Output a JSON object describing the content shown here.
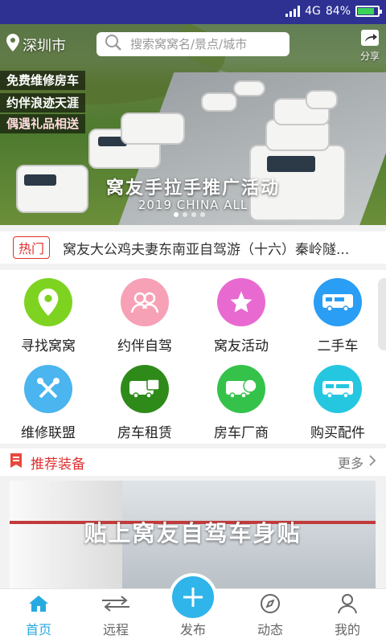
{
  "status_bar": {
    "network": "4G",
    "battery": "84%",
    "battery_level": 0.84
  },
  "header": {
    "location": "深圳市",
    "search_placeholder": "搜索窝窝名/景点/城市",
    "share_label": "分享"
  },
  "banner": {
    "promo_tags": [
      "免费维修房车",
      "约伴浪迹天涯",
      "偶遇礼品相送"
    ],
    "title": "窝友手拉手推广活动",
    "subtitle": "2019 CHINA ALL",
    "slide_count": 4,
    "active_slide": 0
  },
  "hot": {
    "label": "热门",
    "text": "窝友大公鸡夫妻东南亚自驾游（十六）秦岭隧..."
  },
  "grid": [
    {
      "label": "寻找窝窝",
      "icon": "location-pin-icon",
      "color": "#7ed321"
    },
    {
      "label": "约伴自驾",
      "icon": "companions-icon",
      "color": "#f7a1b6"
    },
    {
      "label": "窝友活动",
      "icon": "star-icon",
      "color": "#e86ad1"
    },
    {
      "label": "二手车",
      "icon": "rv-icon",
      "color": "#2a9df4"
    },
    {
      "label": "维修联盟",
      "icon": "tools-icon",
      "color": "#4ab5ee"
    },
    {
      "label": "房车租赁",
      "icon": "rv-rent-icon",
      "color": "#2e8b1a"
    },
    {
      "label": "房车厂商",
      "icon": "rv-view-icon",
      "color": "#35c24a"
    },
    {
      "label": "购买配件",
      "icon": "rv-parts-icon",
      "color": "#25c7e0"
    }
  ],
  "recommend": {
    "title": "推荐装备",
    "more": "更多",
    "card_caption": "贴上窝友自驾车身贴"
  },
  "tabs": [
    {
      "label": "首页",
      "icon": "home-icon",
      "active": true
    },
    {
      "label": "远程",
      "icon": "swap-arrows-icon",
      "active": false
    },
    {
      "label": "发布",
      "icon": "plus-icon",
      "active": false
    },
    {
      "label": "动态",
      "icon": "compass-icon",
      "active": false
    },
    {
      "label": "我的",
      "icon": "user-icon",
      "active": false
    }
  ]
}
